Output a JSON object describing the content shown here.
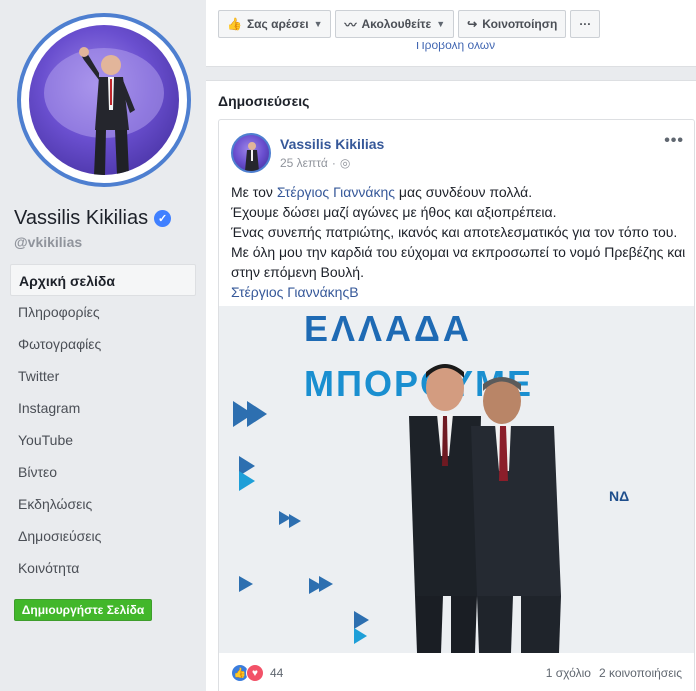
{
  "sidebar": {
    "page_name": "Vassilis Kikilias",
    "handle": "@vkikilias",
    "nav": [
      {
        "label": "Αρχική σελίδα",
        "active": true
      },
      {
        "label": "Πληροφορίες"
      },
      {
        "label": "Φωτογραφίες"
      },
      {
        "label": "Twitter"
      },
      {
        "label": "Instagram"
      },
      {
        "label": "YouTube"
      },
      {
        "label": "Βίντεο"
      },
      {
        "label": "Εκδηλώσεις"
      },
      {
        "label": "Δημοσιεύσεις"
      },
      {
        "label": "Κοινότητα"
      }
    ],
    "create_page": "Δημιουργήστε Σελίδα"
  },
  "actions": {
    "like": "Σας αρέσει",
    "follow": "Ακολουθείτε",
    "share": "Κοινοποίηση",
    "more": "···"
  },
  "cut_link": "Προβολή όλων",
  "posts": {
    "title": "Δημοσιεύσεις",
    "post": {
      "author": "Vassilis Kikilias",
      "time": "25 λεπτά",
      "text_prefix": "Με τον ",
      "mention": "Στέργιος Γιαννάκης",
      "text_suffix": " μας συνδέουν πολλά.",
      "line2": "Έχουμε δώσει μαζί αγώνες με ήθος και αξιοπρέπεια.",
      "line3": "Ένας συνεπής πατριώτης, ικανός και αποτελεσματικός για τον τόπο του. Με όλη μου την καρδιά του εύχομαι να εκπροσωπεί το νομό Πρεβέζης και στην επόμενη Βουλή.",
      "tag": "Στέργιος ΓιαννάκηςΒ",
      "photo_text_line1": "ΕΛΛΑΔΑ",
      "photo_text_line2": "ΜΠΟΡΟΥΜΕ",
      "photo_logo": "ΝΔ",
      "reaction_count": "44",
      "comments": "1 σχόλιο",
      "shares": "2 κοινοποιήσεις"
    }
  },
  "colors": {
    "accent": "#4267b2",
    "link": "#365899",
    "create_button": "#42b72a"
  }
}
